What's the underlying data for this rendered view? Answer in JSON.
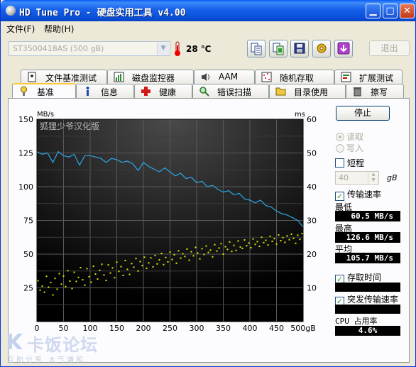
{
  "window": {
    "title": "HD Tune Pro - 硬盘实用工具 v4.00",
    "minimize_glyph": "▁",
    "maximize_glyph": "□",
    "close_glyph": "✕"
  },
  "menu": {
    "file": "文件(F)",
    "help": "帮助(H)"
  },
  "toolbar": {
    "drive": "ST3500418AS (500 gB)",
    "temperature": "28 ℃",
    "exit_label": "退出",
    "buttons": [
      "copy-text-icon",
      "copy-screen-icon",
      "save-icon",
      "options-icon",
      "download-icon"
    ]
  },
  "tabs": {
    "top_row": [
      "文件基准测试",
      "磁盘监控器",
      "AAM",
      "随机存取",
      "扩展测试"
    ],
    "bottom_row": [
      "基准",
      "信息",
      "健康",
      "错误扫描",
      "目录使用",
      "擦写"
    ],
    "active": "基准"
  },
  "side": {
    "stop_label": "停止",
    "read_label": "读取",
    "write_label": "写入",
    "short_label": "短程",
    "short_value": "40",
    "short_unit": "gB",
    "transfer_label": "传输速率",
    "min_label": "最低",
    "min_value": "60.5 MB/s",
    "max_label": "最高",
    "max_value": "126.6 MB/s",
    "avg_label": "平均",
    "avg_value": "105.7 MB/s",
    "access_label": "存取时间",
    "burst_label": "突发传输速率",
    "cpu_label": "CPU 占用率",
    "cpu_value": "4.6%"
  },
  "watermark": {
    "title": "卡饭论坛",
    "subtitle": "互助分享  大气谦和"
  },
  "chart_data": {
    "type": "line",
    "watermark_text": "狐狸少爷汉化版",
    "y_left_unit": "MB/s",
    "y_right_unit": "ms",
    "x_unit": "gB",
    "x_ticks": [
      "0",
      "50",
      "100",
      "150",
      "200",
      "250",
      "300",
      "350",
      "400",
      "450",
      "500gB"
    ],
    "y_left_ticks": [
      "150",
      "125",
      "100",
      "75",
      "50",
      "25"
    ],
    "y_right_ticks": [
      "60",
      "50",
      "40",
      "30",
      "20",
      "10"
    ],
    "xlim": [
      0,
      500
    ],
    "ylim_left": [
      0,
      150
    ],
    "ylim_right": [
      0,
      60
    ],
    "grid": true,
    "colors": {
      "transfer": "#2aa8e8",
      "access": "#e8e800",
      "background": "#000000",
      "grid": "#5a5a5a"
    },
    "series": [
      {
        "name": "传输速率",
        "axis": "left",
        "x": [
          0,
          10,
          20,
          30,
          40,
          50,
          60,
          70,
          80,
          90,
          100,
          110,
          120,
          130,
          140,
          150,
          160,
          170,
          180,
          190,
          200,
          210,
          220,
          230,
          240,
          250,
          260,
          270,
          280,
          290,
          300,
          310,
          320,
          330,
          340,
          350,
          360,
          370,
          380,
          390,
          400,
          410,
          420,
          430,
          440,
          450,
          460,
          470,
          480,
          490,
          500
        ],
        "values": [
          126,
          124,
          125,
          118,
          126,
          123,
          122,
          124,
          116,
          123,
          123,
          122,
          121,
          118,
          121,
          120,
          118,
          119,
          117,
          112,
          118,
          115,
          113,
          111,
          114,
          111,
          108,
          110,
          106,
          107,
          103,
          104,
          100,
          101,
          98,
          96,
          97,
          94,
          95,
          91,
          90,
          88,
          90,
          86,
          85,
          82,
          80,
          79,
          77,
          75,
          70
        ]
      },
      {
        "name": "存取时间",
        "axis": "right",
        "points": [
          [
            2,
            12.1
          ],
          [
            6,
            9.3
          ],
          [
            10,
            10.5
          ],
          [
            14,
            8.7
          ],
          [
            18,
            13.4
          ],
          [
            22,
            10.2
          ],
          [
            26,
            11.6
          ],
          [
            30,
            7.9
          ],
          [
            34,
            12.8
          ],
          [
            38,
            9.6
          ],
          [
            42,
            14.2
          ],
          [
            46,
            11.1
          ],
          [
            50,
            13.5
          ],
          [
            54,
            10.4
          ],
          [
            58,
            15.1
          ],
          [
            62,
            12.0
          ],
          [
            66,
            9.8
          ],
          [
            70,
            14.6
          ],
          [
            74,
            11.9
          ],
          [
            78,
            13.1
          ],
          [
            82,
            16.0
          ],
          [
            86,
            12.4
          ],
          [
            90,
            10.8
          ],
          [
            94,
            15.7
          ],
          [
            98,
            13.3
          ],
          [
            102,
            11.7
          ],
          [
            106,
            16.4
          ],
          [
            110,
            14.1
          ],
          [
            114,
            12.6
          ],
          [
            118,
            15.2
          ],
          [
            122,
            17.0
          ],
          [
            126,
            13.8
          ],
          [
            130,
            12.2
          ],
          [
            134,
            16.8
          ],
          [
            138,
            14.4
          ],
          [
            142,
            15.9
          ],
          [
            146,
            13.0
          ],
          [
            150,
            17.6
          ],
          [
            154,
            14.9
          ],
          [
            158,
            16.3
          ],
          [
            162,
            13.7
          ],
          [
            166,
            18.1
          ],
          [
            170,
            15.5
          ],
          [
            174,
            14.0
          ],
          [
            178,
            17.2
          ],
          [
            182,
            16.1
          ],
          [
            186,
            18.7
          ],
          [
            190,
            15.0
          ],
          [
            194,
            17.8
          ],
          [
            198,
            16.6
          ],
          [
            202,
            19.1
          ],
          [
            206,
            15.8
          ],
          [
            210,
            17.4
          ],
          [
            214,
            18.9
          ],
          [
            218,
            16.2
          ],
          [
            222,
            19.6
          ],
          [
            226,
            17.1
          ],
          [
            230,
            18.3
          ],
          [
            234,
            20.2
          ],
          [
            238,
            16.9
          ],
          [
            242,
            19.0
          ],
          [
            246,
            17.7
          ],
          [
            250,
            20.6
          ],
          [
            254,
            18.4
          ],
          [
            258,
            19.8
          ],
          [
            262,
            17.3
          ],
          [
            266,
            21.0
          ],
          [
            270,
            18.8
          ],
          [
            274,
            20.1
          ],
          [
            278,
            19.3
          ],
          [
            282,
            21.5
          ],
          [
            286,
            18.2
          ],
          [
            290,
            20.7
          ],
          [
            294,
            19.5
          ],
          [
            298,
            22.0
          ],
          [
            302,
            20.3
          ],
          [
            306,
            18.6
          ],
          [
            310,
            21.6
          ],
          [
            314,
            19.9
          ],
          [
            318,
            22.4
          ],
          [
            322,
            20.5
          ],
          [
            326,
            21.2
          ],
          [
            330,
            19.2
          ],
          [
            334,
            22.8
          ],
          [
            338,
            20.9
          ],
          [
            342,
            21.8
          ],
          [
            346,
            23.1
          ],
          [
            350,
            20.0
          ],
          [
            354,
            22.2
          ],
          [
            358,
            21.4
          ],
          [
            362,
            23.6
          ],
          [
            366,
            20.8
          ],
          [
            370,
            22.6
          ],
          [
            374,
            21.1
          ],
          [
            378,
            23.9
          ],
          [
            382,
            22.1
          ],
          [
            386,
            21.7
          ],
          [
            390,
            24.2
          ],
          [
            394,
            22.5
          ],
          [
            398,
            23.3
          ],
          [
            402,
            21.9
          ],
          [
            406,
            24.5
          ],
          [
            410,
            22.9
          ],
          [
            414,
            23.7
          ],
          [
            418,
            22.3
          ],
          [
            422,
            25.0
          ],
          [
            426,
            23.4
          ],
          [
            430,
            24.1
          ],
          [
            434,
            22.7
          ],
          [
            438,
            25.3
          ],
          [
            442,
            23.8
          ],
          [
            446,
            24.6
          ],
          [
            450,
            23.0
          ],
          [
            454,
            25.7
          ],
          [
            458,
            24.0
          ],
          [
            462,
            24.9
          ],
          [
            466,
            23.5
          ],
          [
            470,
            25.4
          ],
          [
            474,
            24.3
          ],
          [
            478,
            25.9
          ],
          [
            482,
            24.7
          ],
          [
            486,
            23.2
          ],
          [
            490,
            25.6
          ],
          [
            494,
            24.4
          ],
          [
            498,
            26.1
          ]
        ]
      }
    ]
  }
}
